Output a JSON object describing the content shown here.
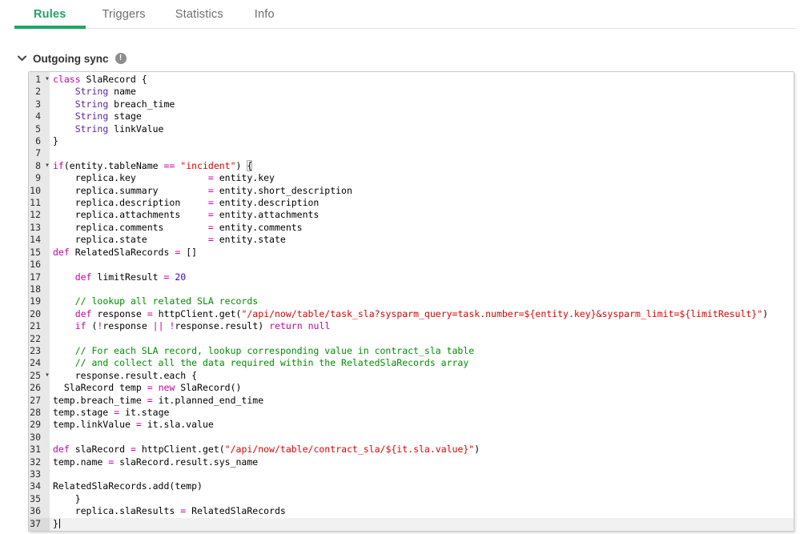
{
  "tabs": [
    {
      "label": "Rules",
      "active": true
    },
    {
      "label": "Triggers",
      "active": false
    },
    {
      "label": "Statistics",
      "active": false
    },
    {
      "label": "Info",
      "active": false
    }
  ],
  "section": {
    "title": "Outgoing sync",
    "info_icon": "!"
  },
  "colors": {
    "accent": "#1fa564",
    "gutter_bg": "#e8e8e8",
    "syntax": {
      "k": "#C800A4",
      "t": "#5C2699",
      "s": "#DF0002",
      "c": "#008E00",
      "n": "#3A00DC",
      "p": "#000000",
      "bm": "#000000"
    }
  },
  "editor": {
    "fold_lines": [
      1,
      8,
      25
    ],
    "active_line": 37,
    "cursor_line": 37,
    "lines": [
      {
        "n": 1,
        "t": [
          [
            "k",
            "class"
          ],
          [
            "p",
            " SlaRecord {"
          ]
        ]
      },
      {
        "n": 2,
        "t": [
          [
            "p",
            "    "
          ],
          [
            "t",
            "String"
          ],
          [
            "p",
            " name"
          ]
        ]
      },
      {
        "n": 3,
        "t": [
          [
            "p",
            "    "
          ],
          [
            "t",
            "String"
          ],
          [
            "p",
            " breach_time"
          ]
        ]
      },
      {
        "n": 4,
        "t": [
          [
            "p",
            "    "
          ],
          [
            "t",
            "String"
          ],
          [
            "p",
            " stage"
          ]
        ]
      },
      {
        "n": 5,
        "t": [
          [
            "p",
            "    "
          ],
          [
            "t",
            "String"
          ],
          [
            "p",
            " linkValue"
          ]
        ]
      },
      {
        "n": 6,
        "t": [
          [
            "p",
            "}"
          ]
        ]
      },
      {
        "n": 7,
        "t": []
      },
      {
        "n": 8,
        "t": [
          [
            "k",
            "if"
          ],
          [
            "p",
            "(entity.tableName "
          ],
          [
            "k",
            "=="
          ],
          [
            "p",
            " "
          ],
          [
            "s",
            "\"incident\""
          ],
          [
            "p",
            ") "
          ],
          [
            "bm",
            "{"
          ]
        ]
      },
      {
        "n": 9,
        "t": [
          [
            "p",
            "    replica.key             "
          ],
          [
            "k",
            "="
          ],
          [
            "p",
            " entity.key"
          ]
        ]
      },
      {
        "n": 10,
        "t": [
          [
            "p",
            "    replica.summary         "
          ],
          [
            "k",
            "="
          ],
          [
            "p",
            " entity.short_description"
          ]
        ]
      },
      {
        "n": 11,
        "t": [
          [
            "p",
            "    replica.description     "
          ],
          [
            "k",
            "="
          ],
          [
            "p",
            " entity.description"
          ]
        ]
      },
      {
        "n": 12,
        "t": [
          [
            "p",
            "    replica.attachments     "
          ],
          [
            "k",
            "="
          ],
          [
            "p",
            " entity.attachments"
          ]
        ]
      },
      {
        "n": 13,
        "t": [
          [
            "p",
            "    replica.comments        "
          ],
          [
            "k",
            "="
          ],
          [
            "p",
            " entity.comments"
          ]
        ]
      },
      {
        "n": 14,
        "t": [
          [
            "p",
            "    replica.state           "
          ],
          [
            "k",
            "="
          ],
          [
            "p",
            " entity.state"
          ]
        ]
      },
      {
        "n": 15,
        "t": [
          [
            "k",
            "def"
          ],
          [
            "p",
            " RelatedSlaRecords "
          ],
          [
            "k",
            "="
          ],
          [
            "p",
            " []"
          ]
        ]
      },
      {
        "n": 16,
        "t": []
      },
      {
        "n": 17,
        "t": [
          [
            "p",
            "    "
          ],
          [
            "k",
            "def"
          ],
          [
            "p",
            " limitResult "
          ],
          [
            "k",
            "="
          ],
          [
            "p",
            " "
          ],
          [
            "n",
            "20"
          ]
        ]
      },
      {
        "n": 18,
        "t": []
      },
      {
        "n": 19,
        "t": [
          [
            "p",
            "    "
          ],
          [
            "c",
            "// lookup all related SLA records"
          ]
        ]
      },
      {
        "n": 20,
        "t": [
          [
            "p",
            "    "
          ],
          [
            "k",
            "def"
          ],
          [
            "p",
            " response "
          ],
          [
            "k",
            "="
          ],
          [
            "p",
            " httpClient.get("
          ],
          [
            "s",
            "\"/api/now/table/task_sla?sysparm_query=task.number=${entity.key}&sysparm_limit=${limitResult}\""
          ],
          [
            "p",
            ")"
          ]
        ]
      },
      {
        "n": 21,
        "t": [
          [
            "p",
            "    "
          ],
          [
            "k",
            "if"
          ],
          [
            "p",
            " ("
          ],
          [
            "k",
            "!"
          ],
          [
            "p",
            "response "
          ],
          [
            "k",
            "||"
          ],
          [
            "p",
            " "
          ],
          [
            "k",
            "!"
          ],
          [
            "p",
            "response.result) "
          ],
          [
            "k",
            "return"
          ],
          [
            "p",
            " "
          ],
          [
            "k",
            "null"
          ]
        ]
      },
      {
        "n": 22,
        "t": []
      },
      {
        "n": 23,
        "t": [
          [
            "p",
            "    "
          ],
          [
            "c",
            "// For each SLA record, lookup corresponding value in contract_sla table"
          ]
        ]
      },
      {
        "n": 24,
        "t": [
          [
            "p",
            "    "
          ],
          [
            "c",
            "// and collect all the data required within the RelatedSlaRecords array"
          ]
        ]
      },
      {
        "n": 25,
        "t": [
          [
            "p",
            "    response.result.each {"
          ]
        ]
      },
      {
        "n": 26,
        "t": [
          [
            "p",
            "  SlaRecord temp "
          ],
          [
            "k",
            "="
          ],
          [
            "p",
            " "
          ],
          [
            "k",
            "new"
          ],
          [
            "p",
            " SlaRecord()"
          ]
        ]
      },
      {
        "n": 27,
        "t": [
          [
            "p",
            "temp.breach_time "
          ],
          [
            "k",
            "="
          ],
          [
            "p",
            " it.planned_end_time"
          ]
        ]
      },
      {
        "n": 28,
        "t": [
          [
            "p",
            "temp.stage "
          ],
          [
            "k",
            "="
          ],
          [
            "p",
            " it.stage"
          ]
        ]
      },
      {
        "n": 29,
        "t": [
          [
            "p",
            "temp.linkValue "
          ],
          [
            "k",
            "="
          ],
          [
            "p",
            " it.sla.value"
          ]
        ]
      },
      {
        "n": 30,
        "t": []
      },
      {
        "n": 31,
        "t": [
          [
            "k",
            "def"
          ],
          [
            "p",
            " slaRecord "
          ],
          [
            "k",
            "="
          ],
          [
            "p",
            " httpClient.get("
          ],
          [
            "s",
            "\"/api/now/table/contract_sla/${it.sla.value}\""
          ],
          [
            "p",
            ")"
          ]
        ]
      },
      {
        "n": 32,
        "t": [
          [
            "p",
            "temp.name "
          ],
          [
            "k",
            "="
          ],
          [
            "p",
            " slaRecord.result.sys_name"
          ]
        ]
      },
      {
        "n": 33,
        "t": []
      },
      {
        "n": 34,
        "t": [
          [
            "p",
            "RelatedSlaRecords.add(temp)"
          ]
        ]
      },
      {
        "n": 35,
        "t": [
          [
            "p",
            "    }"
          ]
        ]
      },
      {
        "n": 36,
        "t": [
          [
            "p",
            "    replica.slaResults "
          ],
          [
            "k",
            "="
          ],
          [
            "p",
            " RelatedSlaRecords"
          ]
        ]
      },
      {
        "n": 37,
        "t": [
          [
            "p",
            "}"
          ]
        ]
      }
    ]
  }
}
